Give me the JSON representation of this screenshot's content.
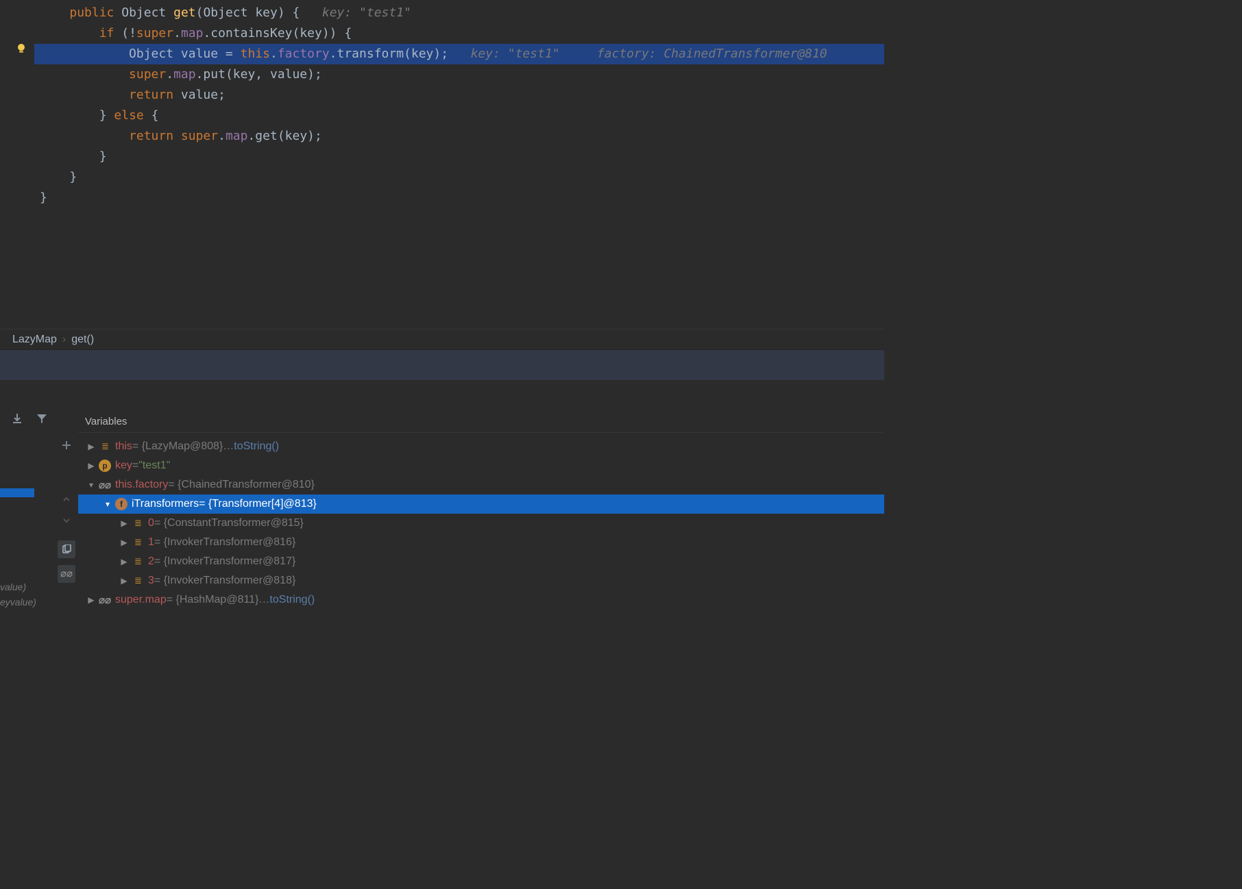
{
  "breadcrumb": {
    "class": "LazyMap",
    "method": "get()"
  },
  "code": {
    "line1_kw": "public",
    "line1_type": "Object",
    "line1_name": "get",
    "line1_args": "(Object key) {",
    "line1_hint": "key: \"test1\"",
    "line2_kw": "if",
    "line2_rest": " (!",
    "line2_kw2": "super",
    "line2_map": "map",
    "line2_call": ".containsKey(key)) {",
    "line3": "Object value = ",
    "line3_this": "this",
    "line3_factory": "factory",
    "line3_call": ".transform(key);",
    "line3_hint1": "key: \"test1\"",
    "line3_hint2": "factory: ChainedTransformer@810",
    "line4_kw": "super",
    "line4_map": "map",
    "line4_rest": ".put(key, value);",
    "line5_kw": "return",
    "line5_rest": " value;",
    "line6": "} ",
    "line6_kw": "else",
    "line6_rest": " {",
    "line7_kw1": "return",
    "line7_kw2": " super",
    "line7_map": "map",
    "line7_rest": ".get(key);",
    "line8": "}",
    "line9": "}",
    "line10": "}"
  },
  "variables_title": "Variables",
  "frames": {
    "f1": "value)",
    "f2": "eyvalue)"
  },
  "vars": {
    "this": {
      "name": "this",
      "val": " = {LazyMap@808}  ",
      "link": "toString()"
    },
    "key": {
      "name": "key",
      "eq": " = ",
      "val": "\"test1\""
    },
    "factory": {
      "name": "this.factory",
      "val": " = {ChainedTransformer@810}"
    },
    "it": {
      "name": "iTransformers",
      "val": " = {Transformer[4]@813}"
    },
    "a0": {
      "name": "0",
      "val": " = {ConstantTransformer@815}"
    },
    "a1": {
      "name": "1",
      "val": " = {InvokerTransformer@816}"
    },
    "a2": {
      "name": "2",
      "val": " = {InvokerTransformer@817}"
    },
    "a3": {
      "name": "3",
      "val": " = {InvokerTransformer@818}"
    },
    "supermap": {
      "name": "super.map",
      "val": " = {HashMap@811}  ",
      "link": "toString()"
    }
  }
}
